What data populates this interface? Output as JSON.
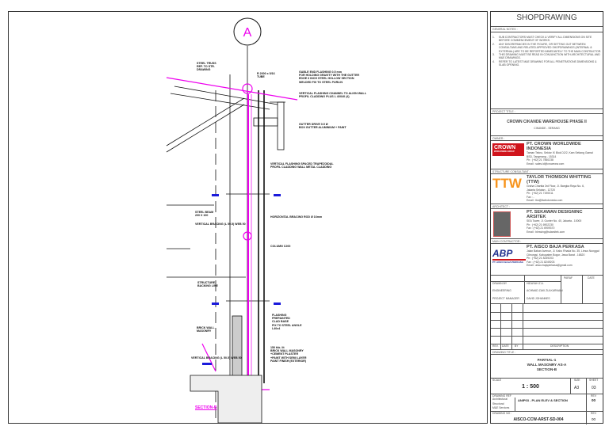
{
  "drawing": {
    "grid_bubble": "A",
    "labels": {
      "steel_truss": "STEEL TRUSS\nREF. TO STR.\nDRAWING",
      "tube": "R 2000 x 5/16\nTUBE",
      "gable": "GABLE END FLASHING 0.5 mm\nFOR HOLDING GRAVITY WITH THE GUTTER\nEDGE 6 INCH STEEL HOLLOW SECTION\nWELDED FIX TO STEEL PURLIN",
      "vertical_flashing": "VERTICAL FLASHING CHANNEL TO ALIGN WALL\nPROFIL CLADDING PLUS L 40X40 (4)",
      "gutter": "GUTTER DRIVE 0.5 Ø\nBOX GUTTER ALUMINIUM + PAINT",
      "vertical_cladding": "VERTICAL FLASHING SPACED TRAPEZOIDAL\nPROFIL CLADDING WALL METAL CLADDING",
      "steel_beam": "STEEL BEAM\n200 X 100",
      "horizontal_bracing": "HORIZONTAL BRACING ROD Ø 16mm",
      "vertical_bracing": "VERTICAL BRACING (L 50.5) WEB 50",
      "column": "COLUMN C200",
      "structure_backing": "STRUCTURE\nBACKING LINE",
      "brick_wall": "BRICK WALL\nMASONRY",
      "flashing": "FLASHING\nPREPAINTED\nCLAD BASE\nFIX TO STEEL ANGLE\nL40x4",
      "wall_note": "150 thk. lit\nBRICK WALL MASONRY\n+CEMENT PLASTER\n+PAINT WITH SEMI LAYER\nPAINT FINISH (EXTERIOR)",
      "vertical_bracing_2": "VERTICAL BRACING (L 50.5) WEB 50",
      "section_tag": "SECTION-B"
    }
  },
  "title_block": {
    "heading": "SHOPDRAWING",
    "general_notes_label": "GENERAL NOTES :",
    "notes": [
      "SUB CONTRACTORS MUST CHECK & VERIFY ALL DIMENSIONS ON SITE BEFORE COMMENCEMENT OF WORKS.",
      "ANY DISCREPANCIES IN THE FIGURE, OR SETTING OUT BETWEEN CONSULTANS AND RELATED APPROVED SHOPDRAWINGS (INTERNAL & EXTERNAL) ARE TO BE REPORTED IMMEDIATELY TO THE MAIN CONTRACTOR.",
      "THIS DRAWING MUST BE READ IN CONJUNCTION WITH ARCHITECTURAL AND M&E DRAWINGS.",
      "REFER TO LATEST M&E DRAWING FOR ALL PENETRATIONS DIMENSIONS & SLAB OPENING."
    ],
    "project_title_label": "PROJECT TITLE :",
    "project_title": "CROWN CIKANDE WAREHOUSE PHASE II",
    "project_location": "CIKANDE - SERANG",
    "owner_label": "OWNER :",
    "owner": {
      "logo": "CROWN",
      "logo_sub": "WORLDWIDE GROUP",
      "name": "PT. CROWN WORLDWIDE INDONESIA",
      "address": "Taman Tekno, Sektor IX Blok D2/2, Kam Setiang Gamal\nBSD, Tangerang - 15314",
      "ph": "Ph      : (+62) 21 7560238",
      "email": "Email   : sales.id@crownww.com"
    },
    "structure_label": "STRUCTURE CONSULTANT :",
    "structure": {
      "logo": "TTW",
      "name": "TAYLOR THOMSON WHITTING (TTW)",
      "address": "Graha Chantia 3rd Floor, Jl. Bangka Raya No. 6,\nJakarta Selatan - 12720",
      "ph": "Ph      : (+62) 21 7190011",
      "fax": "Fax     : -",
      "email": "Email   : ttw@ttwindonesia.com"
    },
    "architect_label": "ARCHITECT :",
    "architect": {
      "name": "PT. SEKAWAN DESIGNINC ARSITEK",
      "address": "SEA Tower, Jl. Gunter No. 40, Jakarta - 10000",
      "ph": "Ph      : (+62) 21 6902230",
      "fax": "Fax     : (+62) 21 6909370",
      "email": "Email   : blessing@sdarsitek.com"
    },
    "contractor_label": "MAIN CONTRACTOR :",
    "contractor": {
      "logo": "ABP",
      "logo_sub": "PT. AISCO BAJA PERKASA",
      "name": "PT. AISCO BAJA PERKASA",
      "address": "Jalan Baban Avenue, Jl. Kabo Rhada No. 35, Limus Nunggal\nCileungsi, Kabupaten Bogor, Jawa Barat - 16820",
      "ph": "Ph      : (+62) 21 8249203",
      "fax": "Fax     : (+62) 21 8249203",
      "email": "Email   : aisco.bajaperkasa@gmail.com"
    },
    "sign": {
      "paraf": "PARAF",
      "date": "DATE",
      "rows": [
        {
          "role": "DRAWN BY",
          "name": "HIDAYAH Z.A."
        },
        {
          "role": "ENGINEERING",
          "name": "ACHMAD ZAKI ZULKARNAIN"
        },
        {
          "role": "PROJECT MANAGER",
          "name": "DAVID JOHANNES"
        }
      ]
    },
    "revision_headers": {
      "rev": "REV.",
      "date": "DATE",
      "by": "BY",
      "desc": "DESCRIPTION"
    },
    "drawing_title_label": "DRAWING TITLE :",
    "drawing_title": [
      "PARTIAL-1",
      "WALL MASONRY AS-A",
      "SECTION-B"
    ],
    "scale_label": "SCALE",
    "scale": "1 : 500",
    "size_label": "SIZE",
    "size": "A3",
    "sheet_label": "SHEET",
    "sheet": "03",
    "ref_label": "DRAWING REF",
    "ref_rows": [
      "Architectural",
      "Structural",
      "M&E Services"
    ],
    "ref_value": "ANIP03 - PLAN ELEV & SECTION",
    "rev_label": "REV",
    "rev_value": "00",
    "drawing_no_label": "DRAWING NO :",
    "drawing_no": "AISCO-CCW-ARST-SD-004",
    "rev2_label": "REV",
    "rev2_value": "00"
  }
}
